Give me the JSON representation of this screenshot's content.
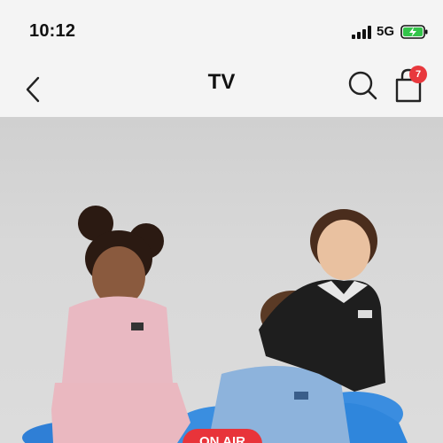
{
  "status_bar": {
    "time": "10:12",
    "network": "5G",
    "icons": [
      "cellular-signal-icon",
      "battery-charging-icon"
    ]
  },
  "nav": {
    "title": "TV",
    "back_icon": "chevron-left-icon",
    "search_icon": "search-icon",
    "cart_icon": "shopping-bag-icon",
    "cart_count": "7"
  },
  "hero": {
    "badge_label": "ON AIR"
  },
  "colors": {
    "badge_red": "#e8383d",
    "background": "#f4f4f4",
    "hero_bg": "#d6d6d6"
  }
}
